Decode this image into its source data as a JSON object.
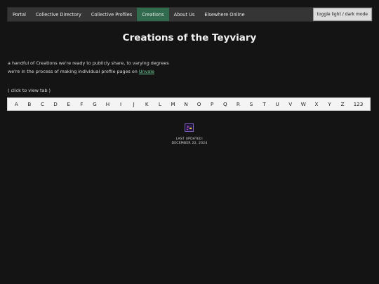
{
  "nav": {
    "items": [
      {
        "label": "Portal"
      },
      {
        "label": "Collective Directory"
      },
      {
        "label": "Collective Profiles"
      },
      {
        "label": "Creations",
        "active": true
      },
      {
        "label": "About Us"
      },
      {
        "label": "Elsewhere Online"
      }
    ],
    "toggle_label": "toggle light / dark mode"
  },
  "page": {
    "title": "Creations of the Teyviary",
    "intro_line1": "a handful of Creations we're ready to publicly share, to varying degrees",
    "intro_line2_prefix": "we're in the process of making individual profile pages on ",
    "intro_link": "Unvale",
    "tab_hint": "( click to view tab )"
  },
  "alphabet": [
    "A",
    "B",
    "C",
    "D",
    "E",
    "F",
    "G",
    "H",
    "I",
    "J",
    "K",
    "L",
    "M",
    "N",
    "O",
    "P",
    "Q",
    "R",
    "S",
    "T",
    "U",
    "V",
    "W",
    "X",
    "Y",
    "Z",
    "123"
  ],
  "footer": {
    "updated_label": "LAST UPDATED:",
    "updated_date": "DECEMBER 22, 2024"
  },
  "colors": {
    "background": "#141414",
    "navbar": "#353535",
    "active_tab": "#2f6b4c",
    "link": "#6fcf9a"
  }
}
